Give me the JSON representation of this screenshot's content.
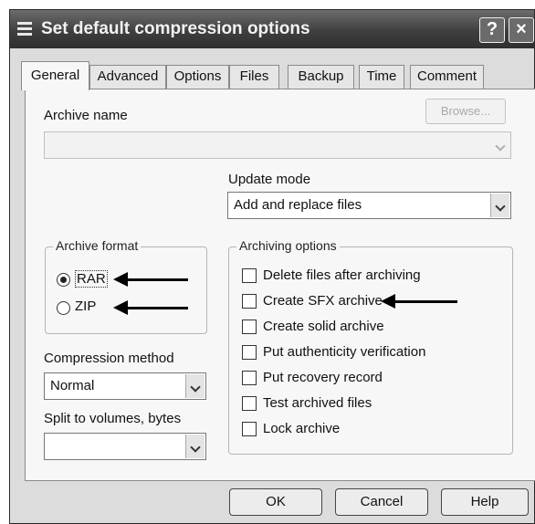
{
  "window": {
    "title": "Set default compression options",
    "help_button": "?",
    "close_button": "×"
  },
  "tabs": [
    {
      "label": "General"
    },
    {
      "label": "Advanced"
    },
    {
      "label": "Options"
    },
    {
      "label": "Files"
    },
    {
      "label": "Backup"
    },
    {
      "label": "Time"
    },
    {
      "label": "Comment"
    }
  ],
  "archive_name": {
    "label": "Archive name",
    "value": "",
    "browse_label": "Browse..."
  },
  "update_mode": {
    "label": "Update mode",
    "value": "Add and replace files"
  },
  "archive_format": {
    "legend": "Archive format",
    "options": [
      {
        "label": "RAR",
        "selected": true
      },
      {
        "label": "ZIP",
        "selected": false
      }
    ]
  },
  "compression_method": {
    "label": "Compression method",
    "value": "Normal"
  },
  "split_volumes": {
    "label": "Split to volumes, bytes",
    "value": ""
  },
  "archiving_options": {
    "legend": "Archiving options",
    "items": [
      {
        "label": "Delete files after archiving",
        "checked": false
      },
      {
        "label": "Create SFX archive",
        "checked": false
      },
      {
        "label": "Create solid archive",
        "checked": false
      },
      {
        "label": "Put authenticity verification",
        "checked": false
      },
      {
        "label": "Put recovery record",
        "checked": false
      },
      {
        "label": "Test archived files",
        "checked": false
      },
      {
        "label": "Lock archive",
        "checked": false
      }
    ]
  },
  "buttons": {
    "ok": "OK",
    "cancel": "Cancel",
    "help": "Help"
  }
}
